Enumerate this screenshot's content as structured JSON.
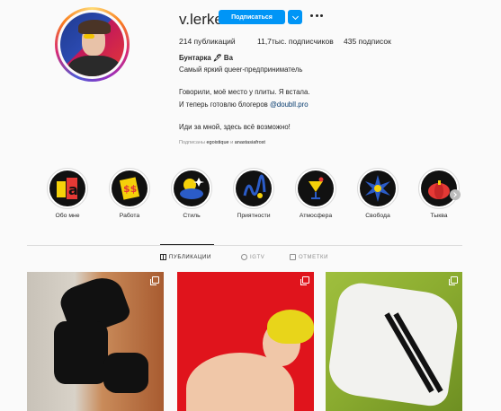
{
  "profile": {
    "username": "v.lerke",
    "follow_label": "Подписаться",
    "stats": {
      "posts": "214 публикаций",
      "followers": "11,7тыс. подписчиков",
      "following": "435 подписок"
    },
    "bio": {
      "name": "Бунтарка 🖋 Ва",
      "category": "Самый яркий queer-предприниматель",
      "line1": "Говорили, моё место у плиты. Я встала.",
      "line2_prefix": "И теперь готовлю блогеров ",
      "line2_link": "@doublI.pro",
      "line3": "Иди за мной, здесь всё возможно!",
      "followed_prefix": "Подписаны ",
      "followed_user1": "egoistique",
      "followed_mid": " и ",
      "followed_user2": "anastasiafrost"
    }
  },
  "highlights": [
    {
      "label": "Обо мне",
      "icon": "letter-a-icon"
    },
    {
      "label": "Работа",
      "icon": "money-icon"
    },
    {
      "label": "Стиль",
      "icon": "cloud-icon"
    },
    {
      "label": "Приятности",
      "icon": "squiggle-icon"
    },
    {
      "label": "Атмосфера",
      "icon": "cocktail-icon"
    },
    {
      "label": "Свобода",
      "icon": "starburst-icon"
    },
    {
      "label": "Тыква",
      "icon": "pumpkin-icon"
    }
  ],
  "tabs": [
    {
      "label": "ПУБЛИКАЦИИ",
      "icon": "grid-icon",
      "active": true
    },
    {
      "label": "IGTV",
      "icon": "igtv-icon",
      "active": false
    },
    {
      "label": "ОТМЕТКИ",
      "icon": "tag-icon",
      "active": false
    }
  ],
  "colors": {
    "accent": "#0095f6",
    "text": "#262626",
    "muted": "#8e8e8e",
    "link": "#00376b",
    "background": "#fafafa"
  }
}
